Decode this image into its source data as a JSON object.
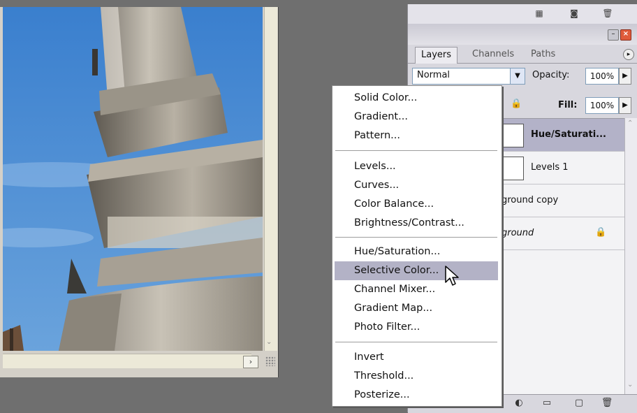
{
  "palette": {
    "tabs": [
      "Layers",
      "Channels",
      "Paths"
    ],
    "blend_mode": "Normal",
    "opacity_label": "Opacity:",
    "opacity_value": "100%",
    "fill_label": "Fill:",
    "fill_value": "100%",
    "layers": [
      {
        "name": "Hue/Saturati...",
        "selected": true
      },
      {
        "name": "Levels 1"
      },
      {
        "name": "ground copy"
      },
      {
        "name": "ground",
        "locked": true
      }
    ]
  },
  "menu": {
    "groups": [
      [
        "Solid Color...",
        "Gradient...",
        "Pattern..."
      ],
      [
        "Levels...",
        "Curves...",
        "Color Balance...",
        "Brightness/Contrast..."
      ],
      [
        "Hue/Saturation...",
        "Selective Color...",
        "Channel Mixer...",
        "Gradient Map...",
        "Photo Filter..."
      ],
      [
        "Invert",
        "Threshold...",
        "Posterize..."
      ]
    ],
    "highlighted": "Selective Color..."
  },
  "icons": {
    "lock": "lock-icon",
    "trash": "trash-icon",
    "new_layer": "new-layer-icon",
    "adjustment": "adjustment-layer-icon",
    "folder": "folder-icon"
  },
  "colors": {
    "menu_highlight": "#b3b2c6",
    "close_button": "#e05b3a",
    "selected_layer": "#b3b2c8"
  }
}
